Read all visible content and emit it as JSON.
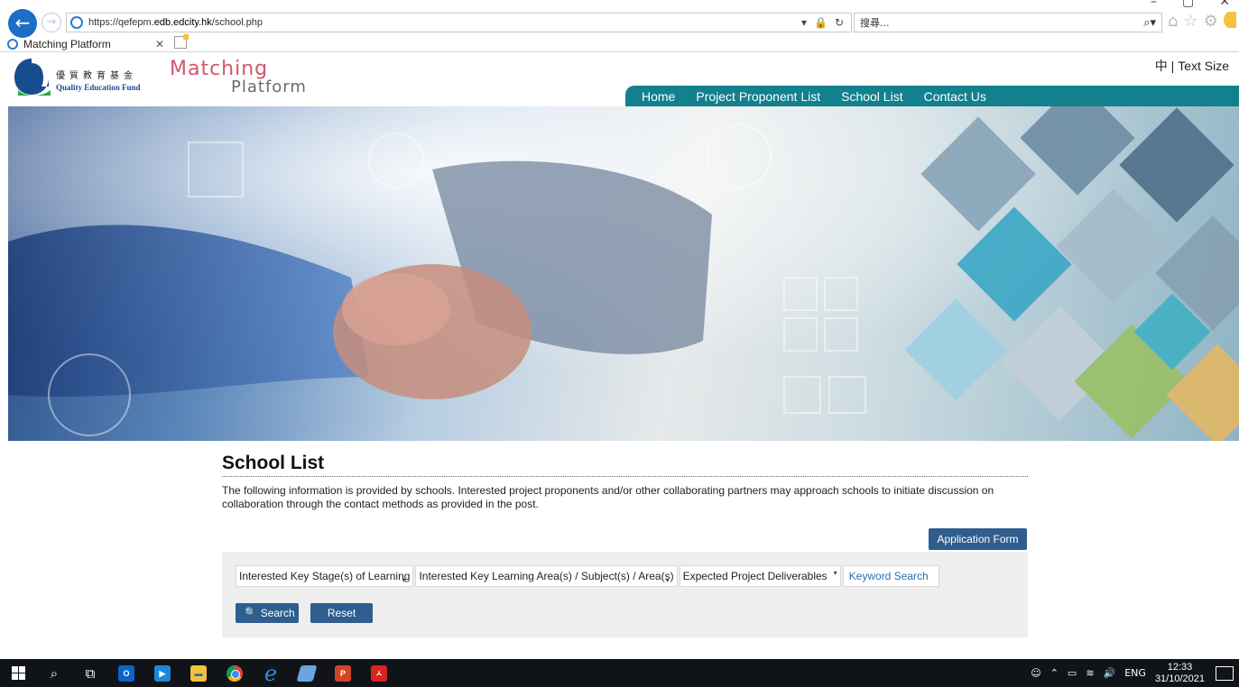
{
  "browser": {
    "url_prefix": "https://qefepm.",
    "url_domain": "edb.edcity.hk",
    "url_path": "/school.php",
    "search_placeholder": "搜尋...",
    "tab_title": "Matching Platform",
    "window_controls": [
      "–",
      "▢",
      "✕"
    ]
  },
  "header": {
    "qef_chinese": "優質教育基金",
    "qef_english": "Quality Education Fund",
    "logo_word1": "Matching",
    "logo_word2": "Platform",
    "lang_label": "中",
    "lang_sep": " | ",
    "text_size_label": "Text Size",
    "nav": {
      "home": "Home",
      "proponents": "Project Proponent List",
      "schools": "School List",
      "contact": "Contact Us"
    }
  },
  "main": {
    "title": "School List",
    "intro": "The following information is provided by schools. Interested project proponents and/or other collaborating partners may approach schools to initiate discussion on collaboration through the contact methods as provided in the post.",
    "application_form_label": "Application Form",
    "filters": {
      "key_stage": "Interested Key Stage(s) of Learning",
      "learning_area": "Interested Key Learning Area(s) / Subject(s) / Area(s)",
      "deliverables": "Expected Project Deliverables",
      "keyword_placeholder": "Keyword Search"
    },
    "search_label": "Search",
    "reset_label": "Reset"
  },
  "taskbar": {
    "language": "ENG",
    "time": "12:33",
    "date": "31/10/2021"
  },
  "colors": {
    "nav_bg": "#13808d",
    "button_bg": "#2f5d8e",
    "panel_bg": "#eeeeee",
    "logo_pink": "#d5556b",
    "taskbar_bg": "#101419"
  }
}
